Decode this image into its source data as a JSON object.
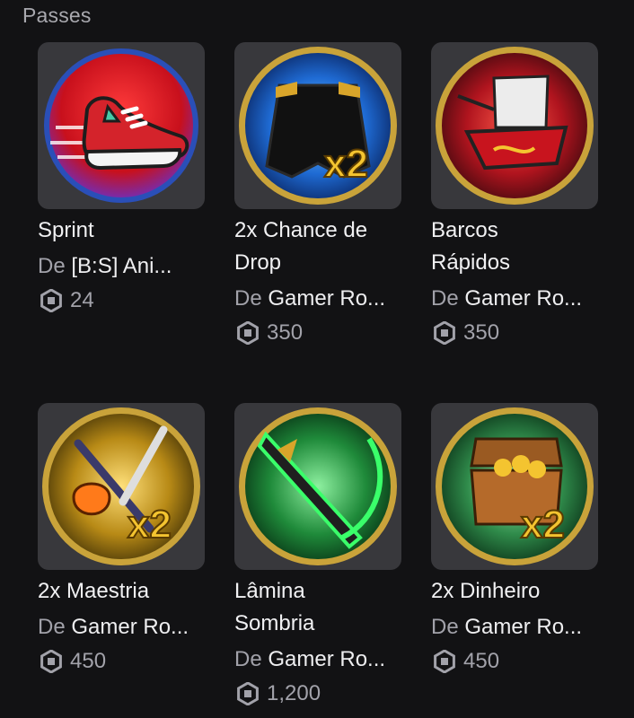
{
  "section": {
    "title": "Passes"
  },
  "passes": [
    {
      "name": "Sprint",
      "creator_prefix": "De",
      "creator": "[B:S] Ani...",
      "price": "24",
      "icon": "sneaker-icon"
    },
    {
      "name": "2x Chance de Drop",
      "creator_prefix": "De",
      "creator": "Gamer Ro...",
      "price": "350",
      "icon": "cape-x2-icon",
      "badge": "x2"
    },
    {
      "name": "Barcos Rápidos",
      "creator_prefix": "De",
      "creator": "Gamer Ro...",
      "price": "350",
      "icon": "pirate-ship-icon"
    },
    {
      "name": "2x Maestria",
      "creator_prefix": "De",
      "creator": "Gamer Ro...",
      "price": "450",
      "icon": "swords-x2-icon",
      "badge": "x2"
    },
    {
      "name": "Lâmina Sombria",
      "creator_prefix": "De",
      "creator": "Gamer Ro...",
      "price": "1,200",
      "icon": "green-blade-icon"
    },
    {
      "name": "2x Dinheiro",
      "creator_prefix": "De",
      "creator": "Gamer Ro...",
      "price": "450",
      "icon": "treasure-chest-x2-icon",
      "badge": "x2"
    }
  ],
  "colors": {
    "background": "#121214",
    "thumb_bg": "#38383c",
    "muted_text": "#a2a2aa",
    "gold_ring": "#c9a33a"
  }
}
